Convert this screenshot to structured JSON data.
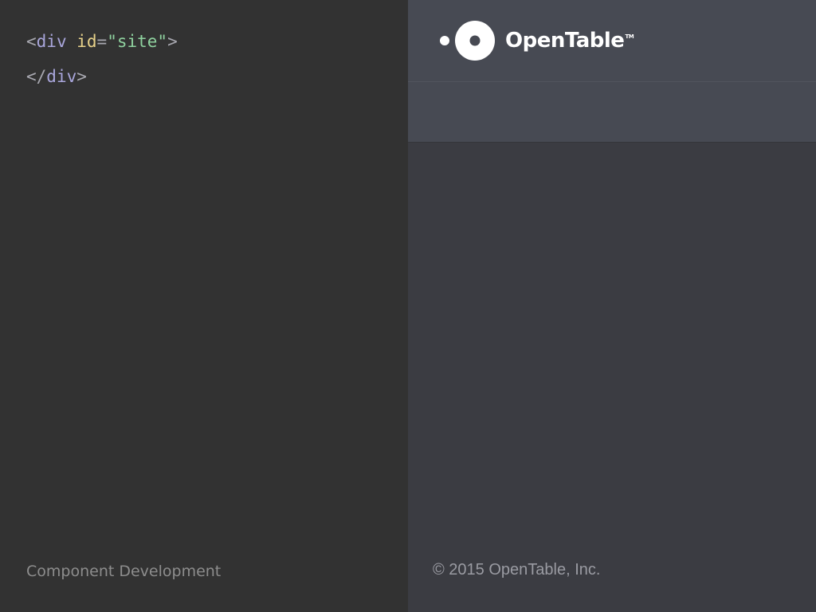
{
  "code": {
    "open_lt": "<",
    "open_tag": "div",
    "space": " ",
    "attr_name": "id",
    "eq": "=",
    "attr_value": "\"site\"",
    "open_gt": ">",
    "close_lt": "</",
    "close_tag": "div",
    "close_gt": ">"
  },
  "caption": "Component Development",
  "brand": {
    "name": "OpenTable",
    "tm": "TM"
  },
  "footer": {
    "copyright": "© 2015 OpenTable, Inc."
  },
  "colors": {
    "left_bg": "#323232",
    "right_bg": "#3b3c42",
    "header_bg": "#474a53",
    "tag": "#a9a6db",
    "attr": "#e8d28a",
    "string": "#8fd29f"
  },
  "icons": {
    "logo": "opentable-logo-icon"
  }
}
